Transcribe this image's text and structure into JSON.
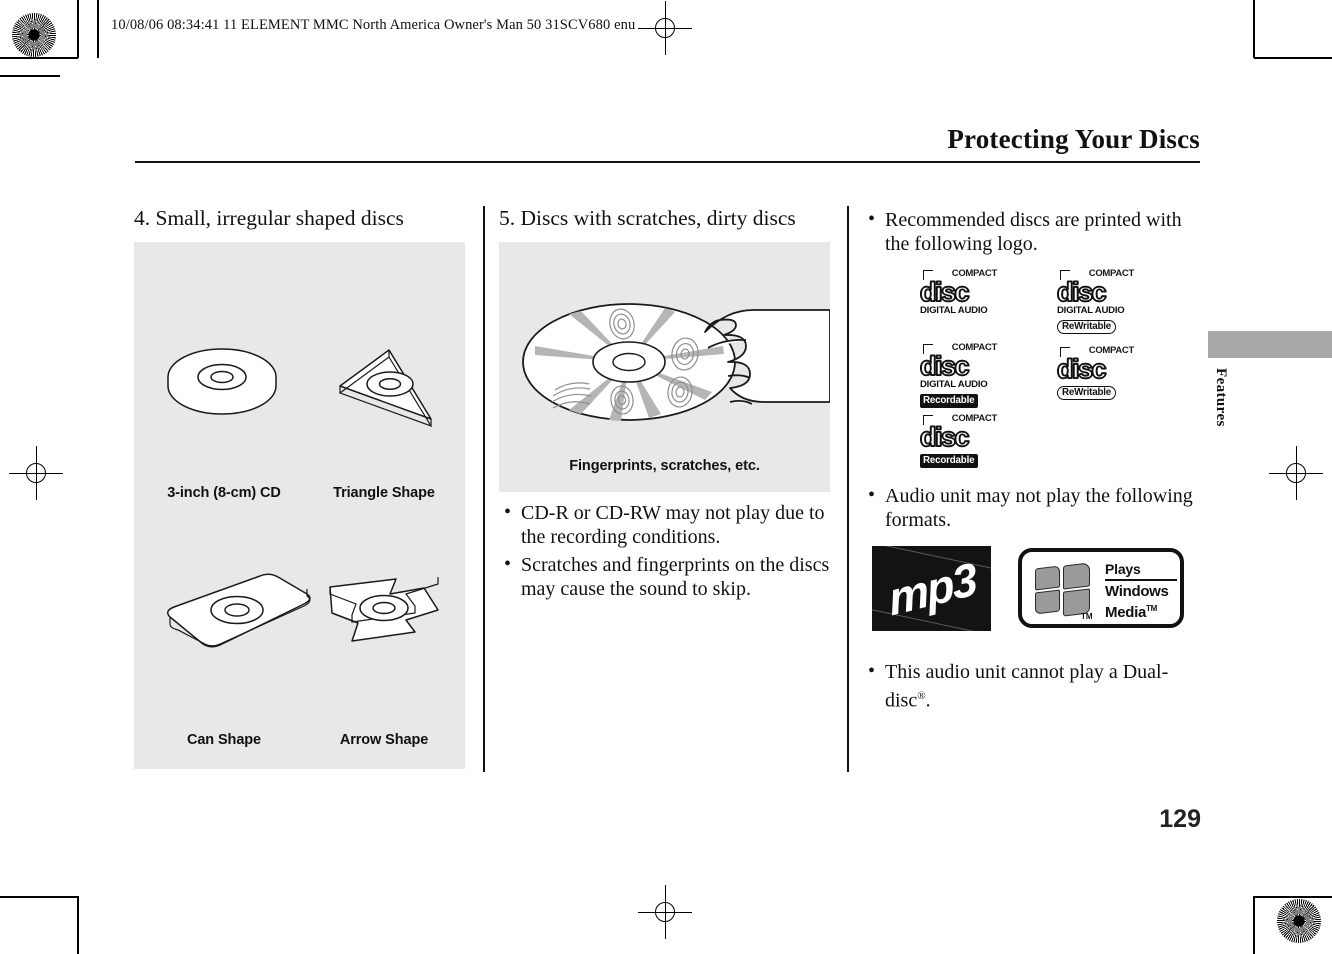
{
  "print_header": "10/08/06 08:34:41    11 ELEMENT MMC North America Owner's Man 50 31SCV680 enu",
  "page": {
    "title": "Protecting Your Discs",
    "number": "129",
    "side_tab_label": "Features"
  },
  "columns": {
    "left": {
      "heading": "4. Small, irregular shaped discs",
      "figure_captions": [
        "3-inch (8-cm) CD",
        "Triangle Shape",
        "Can Shape",
        "Arrow Shape"
      ]
    },
    "middle": {
      "heading": "5. Discs with scratches, dirty discs",
      "figure_caption": "Fingerprints, scratches, etc.",
      "bullets": [
        "CD-R or CD-RW may not play due to the recording conditions.",
        "Scratches and fingerprints on the discs may cause the sound to skip."
      ]
    },
    "right": {
      "bullet_logo": "Recommended discs are printed with the following logo.",
      "bullet_formats": "Audio unit may not play the following formats.",
      "bullet_dualdisc": "This audio unit cannot play a Dual-disc",
      "bullet_dualdisc_sup": "®",
      "bullet_dualdisc_end": ".",
      "cd_logos": [
        {
          "compact": "COMPACT",
          "disc": "disc",
          "digital_audio": "DIGITAL AUDIO",
          "badge": "",
          "badge_style": "none"
        },
        {
          "compact": "COMPACT",
          "disc": "disc",
          "digital_audio": "DIGITAL AUDIO",
          "badge": "ReWritable",
          "badge_style": "outline"
        },
        {
          "compact": "COMPACT",
          "disc": "disc",
          "digital_audio": "DIGITAL AUDIO",
          "badge": "Recordable",
          "badge_style": "filled"
        },
        {
          "compact": "COMPACT",
          "disc": "disc",
          "digital_audio": "",
          "badge": "ReWritable",
          "badge_style": "outline"
        },
        {
          "compact": "COMPACT",
          "disc": "disc",
          "digital_audio": "",
          "badge": "Recordable",
          "badge_style": "filled"
        }
      ],
      "mp3_logo_label": "mp3",
      "wma_logo": {
        "plays": "Plays",
        "windows": "Windows",
        "media": "Media",
        "tm_flag": "TM",
        "tm_media": "TM"
      }
    }
  },
  "colors": {
    "figure_background": "#e8e8e8",
    "side_tab": "#a9a9a9",
    "text": "#111111"
  }
}
